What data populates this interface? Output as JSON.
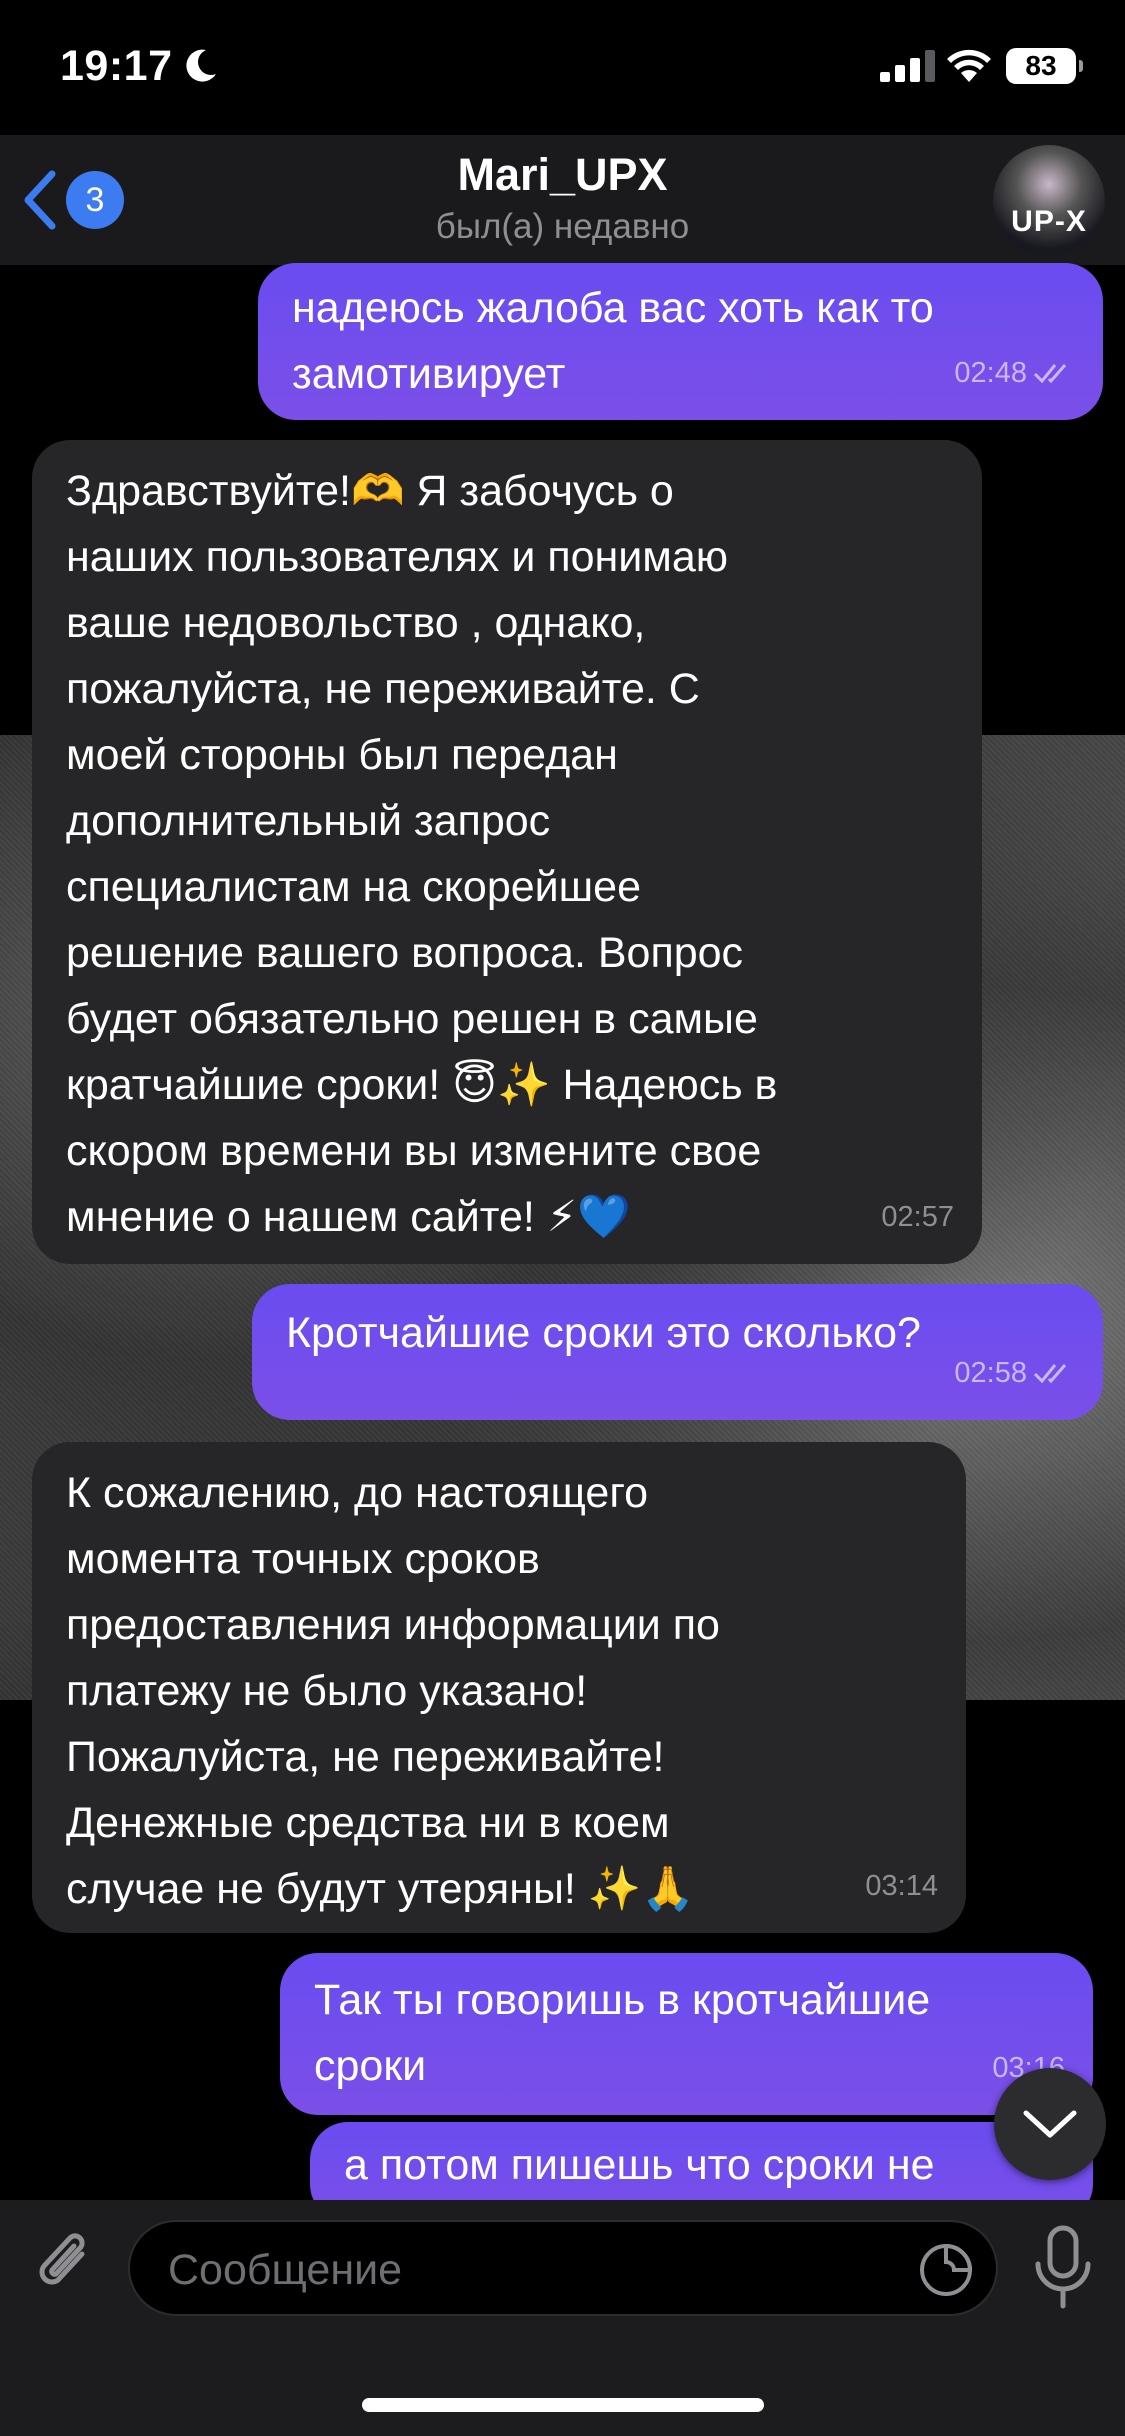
{
  "status_bar": {
    "time": "19:17",
    "battery": "83"
  },
  "header": {
    "back_badge": "3",
    "title": "Mari_UPX",
    "subtitle": "был(а) недавно",
    "avatar_label": "UP-X"
  },
  "messages": [
    {
      "direction": "out",
      "text": "надеюсь жалоба вас хоть как то\nзамотивирует",
      "time": "02:48",
      "read": true
    },
    {
      "direction": "in",
      "text": "Здравствуйте!🫶 Я забочусь о\nнаших пользователях и понимаю\nваше недовольство , однако,\nпожалуйста, не переживайте. С\nмоей стороны был передан\nдополнительный запрос\nспециалистам на скорейшее\nрешение вашего вопроса. Вопрос\nбудет обязательно решен в самые\nкратчайшие сроки! 😇✨ Надеюсь в\nскором времени вы измените свое\nмнение о нашем сайте! ⚡💙",
      "time": "02:57"
    },
    {
      "direction": "out",
      "text": "Кротчайшие сроки это сколько?",
      "time": "02:58",
      "read": true
    },
    {
      "direction": "in",
      "text": "К сожалению, до настоящего\nмомента точных сроков\nпредоставления информации по\nплатежу не было указано!\nПожалуйста, не переживайте!\nДенежные средства ни в коем\nслучае не будут утеряны! ✨🙏",
      "time": "03:14"
    },
    {
      "direction": "out",
      "text": "Так ты говоришь в кротчайшие\nсроки",
      "time": "03:16",
      "read": false
    },
    {
      "direction": "out",
      "text": "а потом пишешь что сроки не",
      "time": ""
    }
  ],
  "input": {
    "placeholder": "Сообщение"
  }
}
